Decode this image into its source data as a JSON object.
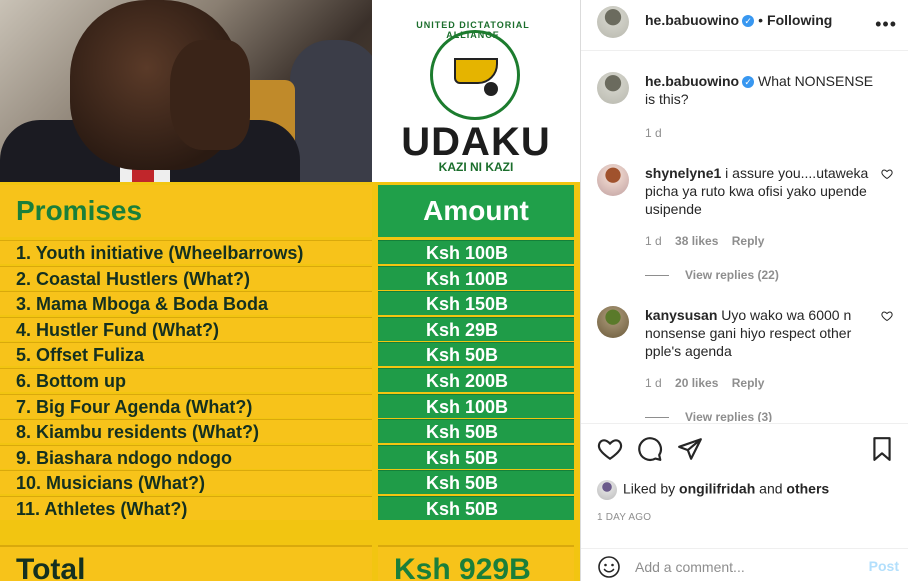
{
  "image": {
    "logo": {
      "arc_text": "UNITED DICTATORIAL ALLIANCE",
      "name": "UDAKU",
      "tagline": "KAZI NI KAZI"
    },
    "table": {
      "header_left": "Promises",
      "header_right": "Amount",
      "rows": [
        {
          "label": "1. Youth initiative (Wheelbarrows)",
          "amount": "Ksh 100B"
        },
        {
          "label": "2. Coastal Hustlers (What?)",
          "amount": "Ksh 100B"
        },
        {
          "label": "3. Mama Mboga & Boda Boda",
          "amount": "Ksh 150B"
        },
        {
          "label": "4. Hustler Fund (What?)",
          "amount": "Ksh 29B"
        },
        {
          "label": "5. Offset Fuliza",
          "amount": "Ksh 50B"
        },
        {
          "label": "6. Bottom up",
          "amount": "Ksh 200B"
        },
        {
          "label": "7. Big Four Agenda (What?)",
          "amount": "Ksh 100B"
        },
        {
          "label": "8. Kiambu residents (What?)",
          "amount": "Ksh  50B"
        },
        {
          "label": "9. Biashara ndogo ndogo",
          "amount": "Ksh  50B"
        },
        {
          "label": "10. Musicians (What?)",
          "amount": "Ksh  50B"
        },
        {
          "label": "11. Athletes (What?)",
          "amount": "Ksh  50B"
        }
      ],
      "total_label": "Total",
      "total_amount": "Ksh 929B"
    },
    "colors": {
      "yellow": "#f7c31a",
      "green": "#1f9c48"
    }
  },
  "header": {
    "username": "he.babuowino",
    "separator": "•",
    "follow_status": "Following"
  },
  "caption": {
    "username": "he.babuowino",
    "text": "What NONSENSE is this?",
    "time": "1 d"
  },
  "comments": [
    {
      "username": "shynelyne1",
      "text": "i assure you....utaweka picha ya ruto kwa ofisi yako upende usipende",
      "time": "1 d",
      "likes": "38 likes",
      "reply": "Reply",
      "view_replies": "View replies (22)"
    },
    {
      "username": "kanysusan",
      "text": "Uyo wako wa 6000 n nonsense gani hiyo respect other pple's agenda",
      "time": "1 d",
      "likes": "20 likes",
      "reply": "Reply",
      "view_replies": "View replies (3)"
    }
  ],
  "actions": {
    "liked_prefix": "Liked by",
    "liked_user": "ongilifridah",
    "liked_and": "and",
    "liked_others": "others",
    "time_ago": "1 DAY AGO"
  },
  "add_comment": {
    "placeholder": "Add a comment...",
    "post_label": "Post"
  },
  "icons": [
    "verified-badge-icon",
    "more-options-icon",
    "heart-icon",
    "comment-icon",
    "share-icon",
    "bookmark-icon",
    "emoji-icon"
  ]
}
